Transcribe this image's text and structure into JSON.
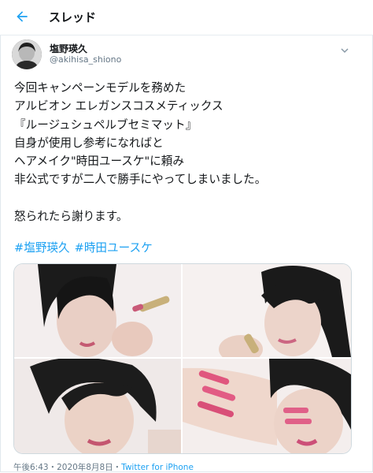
{
  "header": {
    "title": "スレッド",
    "back_icon": "back-arrow-icon"
  },
  "tweet": {
    "display_name": "塩野瑛久",
    "handle": "@akihisa_shiono",
    "lines": [
      "今回キャンペーンモデルを務めた",
      "アルビオン エレガンスコスメティックス",
      "『ルージュシュペルブセミマット』",
      "自身が使用し参考になればと",
      "ヘアメイク\"時田ユースケ\"に頼み",
      "非公式ですが二人で勝手にやってしまいました。",
      "",
      "怒られたら謝ります。"
    ],
    "hashtags": [
      "#塩野瑛久",
      "#時田ユースケ"
    ],
    "date": "午後6:43・2020年8月8日・",
    "source": "Twitter for iPhone"
  },
  "colors": {
    "accent": "#1da1f2",
    "muted": "#657786",
    "border": "#e6ecf0"
  }
}
